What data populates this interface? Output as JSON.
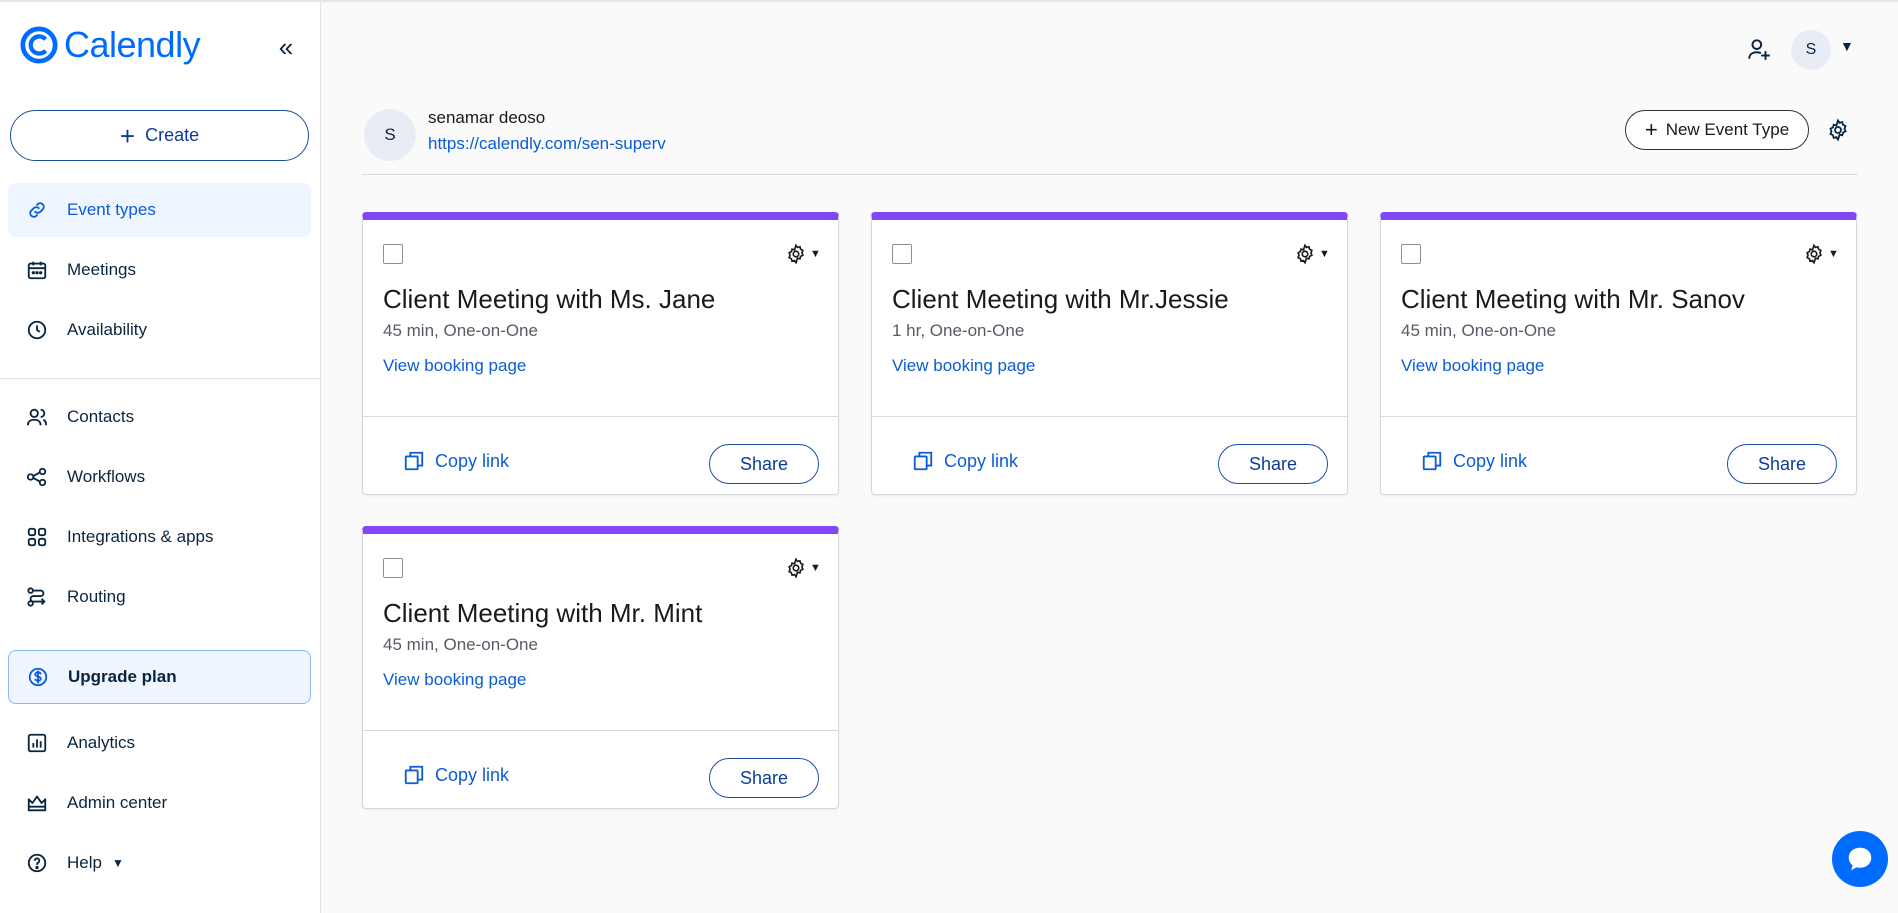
{
  "app": {
    "brand": "Calendly",
    "brand_color": "#006bff",
    "accent_color": "#8247f5"
  },
  "sidebar": {
    "collapse_icon": "double-chevron-left-icon",
    "create_label": "Create",
    "items": [
      {
        "label": "Event types",
        "icon": "link-icon",
        "active": true
      },
      {
        "label": "Meetings",
        "icon": "calendar-icon"
      },
      {
        "label": "Availability",
        "icon": "clock-icon"
      },
      {
        "label": "Contacts",
        "icon": "contacts-icon"
      },
      {
        "label": "Workflows",
        "icon": "workflows-icon"
      },
      {
        "label": "Integrations & apps",
        "icon": "grid-icon"
      },
      {
        "label": "Routing",
        "icon": "routing-icon"
      },
      {
        "label": "Upgrade plan",
        "icon": "dollar-icon"
      },
      {
        "label": "Analytics",
        "icon": "analytics-icon"
      },
      {
        "label": "Admin center",
        "icon": "crown-icon"
      },
      {
        "label": "Help",
        "icon": "help-icon"
      }
    ]
  },
  "topbar": {
    "avatar_initial": "S"
  },
  "profile": {
    "initial": "S",
    "name": "senamar deoso",
    "link": "https://calendly.com/sen-superv"
  },
  "header": {
    "new_event_label": "New Event Type"
  },
  "event_types": [
    {
      "title": "Client Meeting with Ms. Jane",
      "meta": "45 min, One-on-One",
      "booking_label": "View booking page",
      "copy_label": "Copy link",
      "share_label": "Share"
    },
    {
      "title": "Client Meeting with Mr.Jessie",
      "meta": "1 hr, One-on-One",
      "booking_label": "View booking page",
      "copy_label": "Copy link",
      "share_label": "Share"
    },
    {
      "title": "Client Meeting with Mr. Sanov",
      "meta": "45 min, One-on-One",
      "booking_label": "View booking page",
      "copy_label": "Copy link",
      "share_label": "Share"
    },
    {
      "title": "Client Meeting with Mr. Mint",
      "meta": "45 min, One-on-One",
      "booking_label": "View booking page",
      "copy_label": "Copy link",
      "share_label": "Share"
    }
  ]
}
